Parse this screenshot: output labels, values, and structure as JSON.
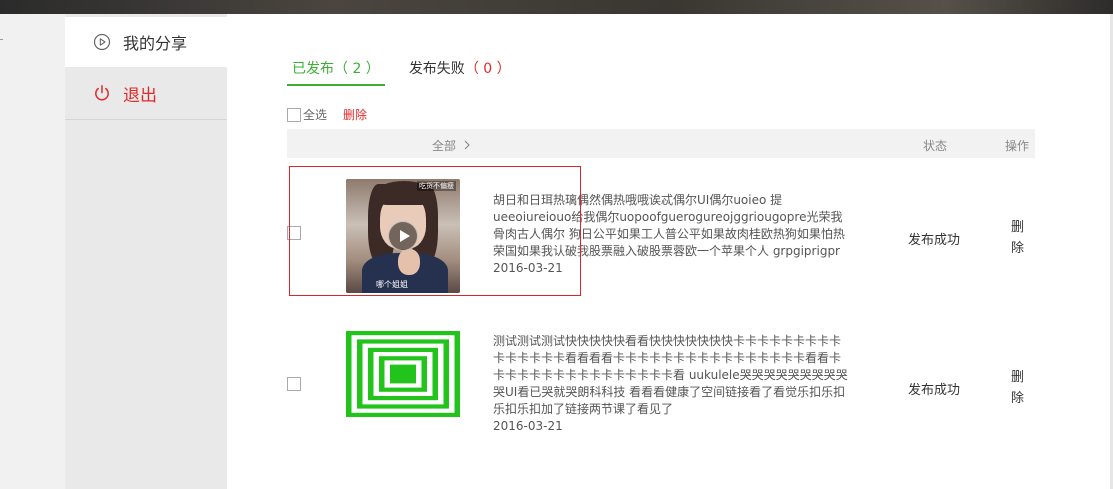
{
  "sidebar": {
    "items": [
      {
        "label": "我的分享",
        "icon": "play-circle-icon"
      },
      {
        "label": "退出",
        "icon": "power-icon"
      }
    ]
  },
  "tabs": [
    {
      "label": "已发布",
      "count": "（ 2 ）",
      "active": true
    },
    {
      "label": "发布失败",
      "count": "（ 0 ）",
      "active": false
    }
  ],
  "toolbar": {
    "select_all": "全选",
    "delete": "删除"
  },
  "table": {
    "headers": {
      "all": "全部",
      "status": "状态",
      "action": "操作"
    },
    "rows": [
      {
        "thumbnail": "video-thumbnail",
        "thumb_badge": "吃货不偏瘦",
        "thumb_caption": "哪个姐姐",
        "description": "胡日和日珥热璃偶然偶热哦哦诶忒偶尔UI偶尔uoieo 提ueeoiureiouo给我偶尔uopoofguerogureojggriougopre光荣我骨肉古人偶尔 狗日公平如果工人普公平如果故肉桂欧热狗如果怕热荣国如果我认破我股票融入破股票蓉欧一个苹果个人 grpgiprigpr",
        "date": "2016-03-21",
        "status": "发布成功",
        "action": "删除"
      },
      {
        "thumbnail": "green-squares-thumbnail",
        "description": "测试测试测试快快快快快看看快快快快快快快卡卡卡卡卡卡卡卡卡卡卡卡卡卡卡看看看看卡卡卡卡卡卡卡卡卡卡卡卡卡卡卡卡看看卡卡卡卡卡卡卡卡卡卡卡卡卡卡卡卡看 uukulele哭哭哭哭哭哭哭哭哭哭UI看已哭就哭朗科科技 看看看健康了空间链接看了看觉乐扣乐扣乐扣乐扣加了链接两节课了看见了",
        "date": "2016-03-21",
        "status": "发布成功",
        "action": "删除"
      }
    ]
  },
  "colors": {
    "accent_green": "#3cb034",
    "accent_red": "#e02b2b"
  }
}
